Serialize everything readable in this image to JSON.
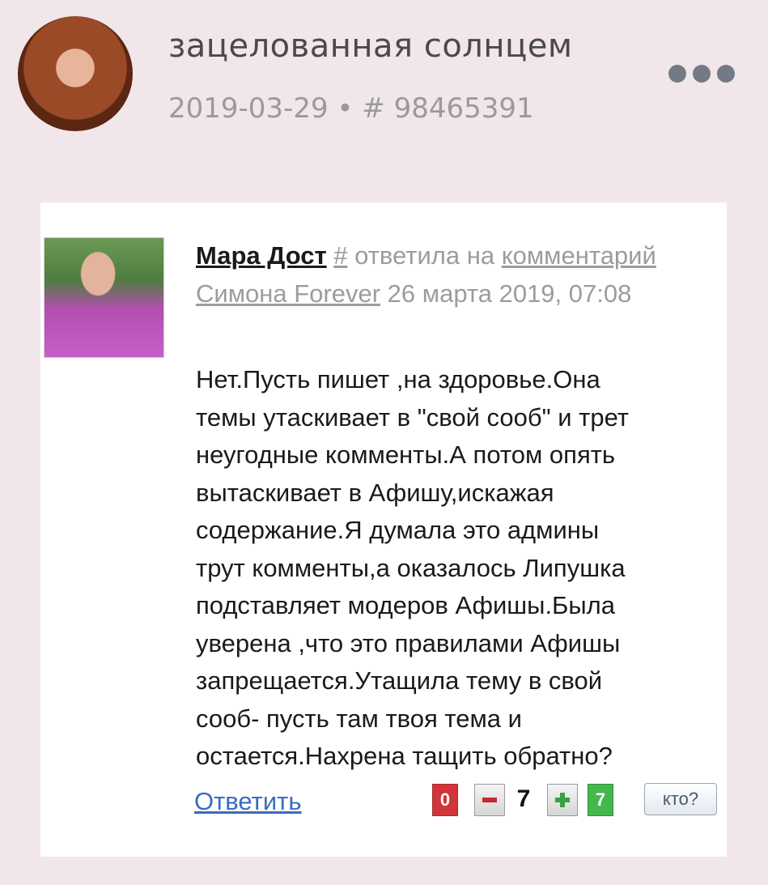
{
  "post": {
    "author": "зацелованная солнцем",
    "date": "2019-03-29",
    "separator": "•",
    "id": "# 98465391",
    "more_icon": "ellipsis-icon"
  },
  "comment": {
    "author": "Мара Дост",
    "hash": "#",
    "action": "ответила на",
    "link_comment": "комментарий",
    "link_user": "Симона Forever",
    "datetime": "26 марта 2019, 07:08",
    "body": "Нет.Пусть пишет ,на здоровье.Она\nтемы утаскивает в \"свой сооб\" и трет\nнеугодные комменты.А потом опять\nвытаскивает в Афишу,искажая\nсодержание.Я думала это админы\nтрут комменты,а оказалось Липушка\nподставляет модеров Афишы.Была\nуверена ,что это правилами Афишы\nзапрещается.Утащила тему в свой\nсооб- пусть там твоя тема и\nостается.Нахрена тащить обратно?",
    "reply_label": "Ответить",
    "votes_negative": "0",
    "score": "7",
    "votes_positive": "7",
    "who_label": "кто?"
  },
  "colors": {
    "page_bg": "#f1e6e9",
    "negative": "#d1343a",
    "positive": "#45b84b",
    "link": "#3a6cc0"
  }
}
